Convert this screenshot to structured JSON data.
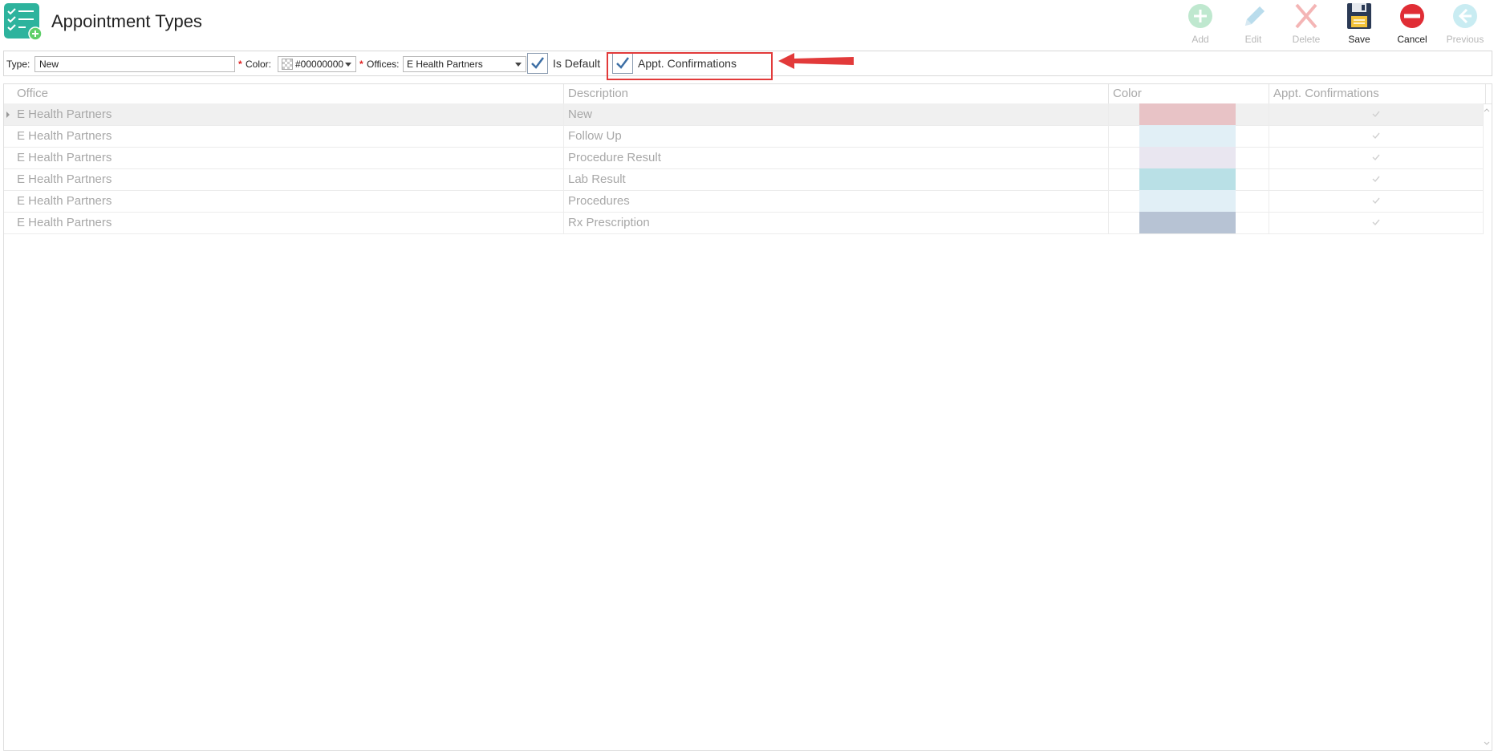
{
  "header": {
    "title": "Appointment Types"
  },
  "toolbar": {
    "buttons": [
      {
        "label": "Add",
        "icon": "add-icon",
        "enabled": false
      },
      {
        "label": "Edit",
        "icon": "pencil-icon",
        "enabled": false
      },
      {
        "label": "Delete",
        "icon": "delete-x-icon",
        "enabled": false
      },
      {
        "label": "Save",
        "icon": "floppy-disk-icon",
        "enabled": true
      },
      {
        "label": "Cancel",
        "icon": "cancel-icon",
        "enabled": true
      },
      {
        "label": "Previous",
        "icon": "back-arrow-icon",
        "enabled": false
      }
    ]
  },
  "form": {
    "type_label": "Type:",
    "type_value": "New",
    "color_label": "Color:",
    "color_value": "#00000000",
    "offices_label": "Offices:",
    "offices_value": "E Health Partners",
    "required_marker": "*",
    "is_default_label": "Is Default",
    "is_default_checked": true,
    "appt_confirmations_label": "Appt. Confirmations",
    "appt_confirmations_checked": true
  },
  "grid": {
    "columns": {
      "office": "Office",
      "description": "Description",
      "color": "Color",
      "confirmations": "Appt. Confirmations"
    },
    "rows": [
      {
        "office": "E Health Partners",
        "description": "New",
        "color": "#e8c3c6",
        "confirm": true,
        "selected": true
      },
      {
        "office": "E Health Partners",
        "description": "Follow Up",
        "color": "#e1eff6",
        "confirm": true,
        "selected": false
      },
      {
        "office": "E Health Partners",
        "description": "Procedure Result",
        "color": "#e9e6f0",
        "confirm": true,
        "selected": false
      },
      {
        "office": "E Health Partners",
        "description": "Lab Result",
        "color": "#b9e0e6",
        "confirm": true,
        "selected": false
      },
      {
        "office": "E Health Partners",
        "description": "Procedures",
        "color": "#e1eff6",
        "confirm": true,
        "selected": false
      },
      {
        "office": "E Health Partners",
        "description": "Rx Prescription",
        "color": "#b7c3d4",
        "confirm": true,
        "selected": false
      }
    ]
  },
  "colors": {
    "highlight": "#e23a3a",
    "check": "#3d6fa5",
    "app_icon": "#2db39d"
  }
}
